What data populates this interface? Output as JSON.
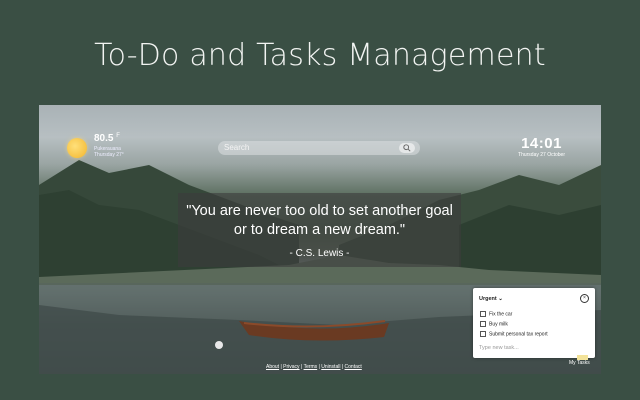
{
  "promo": {
    "title": "To-Do and Tasks Management"
  },
  "weather": {
    "temperature": "80.5",
    "unit": "F",
    "location_line1": "Pukerauana",
    "location_line2": "Thursday 27°",
    "icon": "sun-icon"
  },
  "search": {
    "placeholder": "Search",
    "icon": "search-icon"
  },
  "clock": {
    "time": "14:01",
    "date": "Thursday 27 October"
  },
  "quote": {
    "text": "\"You are never too old to set another goal or to dream a new dream.\"",
    "author": "- C.S. Lewis -"
  },
  "footer": {
    "links": [
      "About",
      "Privacy",
      "Terms",
      "Uninstall",
      "Contact"
    ],
    "separator": " | "
  },
  "tasks": {
    "list_name": "Urgent",
    "items": [
      "Fix the car",
      "Buy milk",
      "Submit personal tax report"
    ],
    "input_placeholder": "Type new task...",
    "toggle_label": "My Tasks"
  },
  "colors": {
    "page_bg": "#3a4f44",
    "quote_bg": "rgba(60,60,60,0.6)",
    "sun": "#f2b52c"
  }
}
